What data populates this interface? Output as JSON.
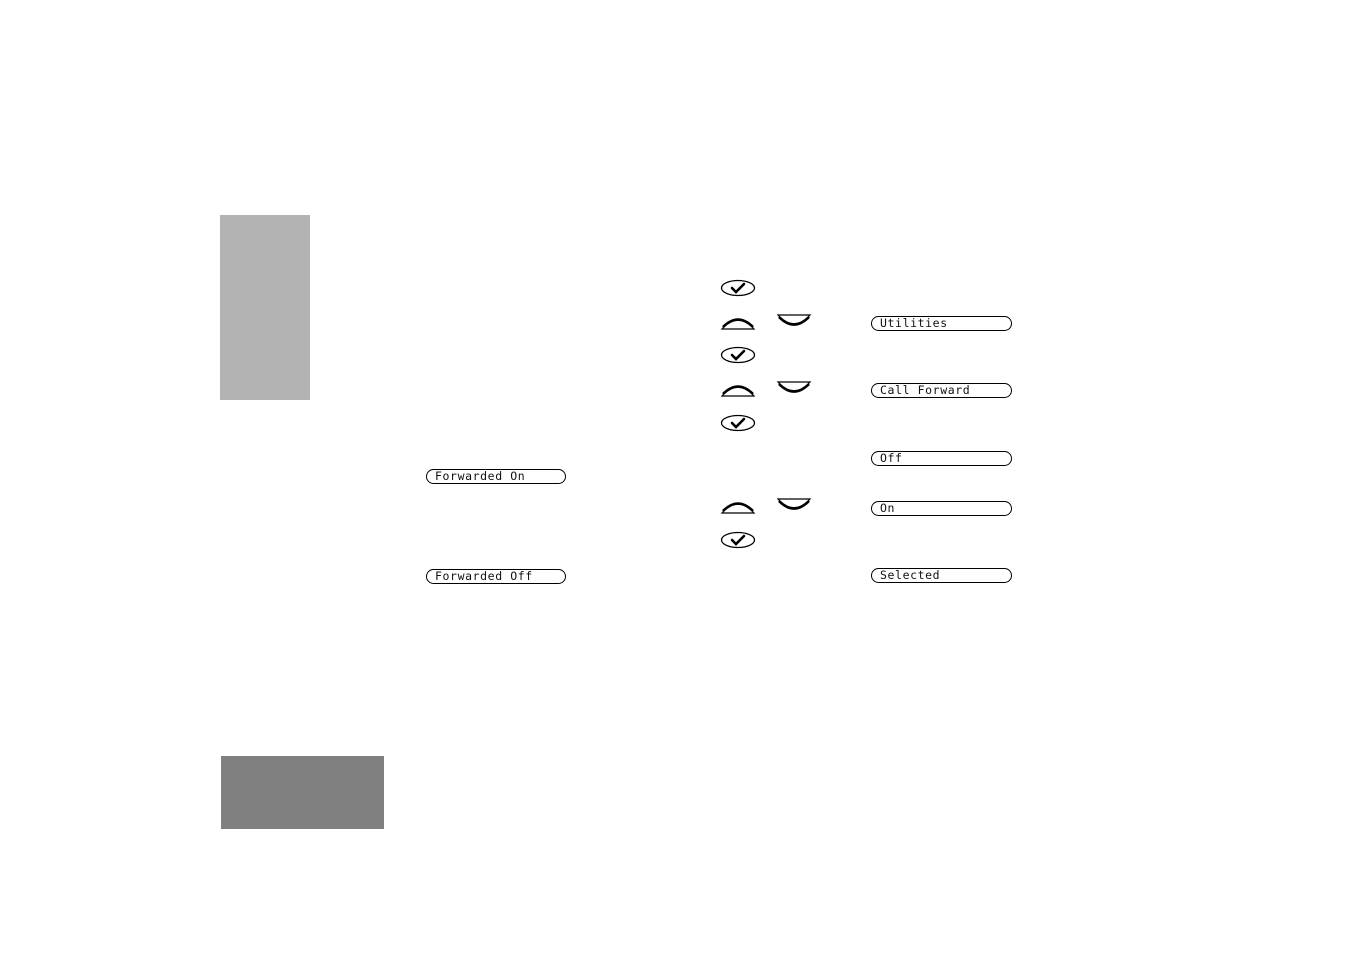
{
  "page": {
    "side_tabs": [
      {
        "name": "upper-tab",
        "color": "#b3b3b3"
      },
      {
        "name": "lower-tab",
        "color": "#808080"
      }
    ]
  },
  "procedure": {
    "steps": [
      {
        "keys": [
          "select-key"
        ],
        "display": ""
      },
      {
        "keys": [
          "scroll-up-key",
          "scroll-down-key"
        ],
        "display": "Utilities"
      },
      {
        "keys": [
          "select-key"
        ],
        "display": ""
      },
      {
        "keys": [
          "scroll-up-key",
          "scroll-down-key"
        ],
        "display": "Call Forward"
      },
      {
        "keys": [
          "select-key"
        ],
        "display": "Off"
      },
      {
        "keys": [
          "scroll-up-key",
          "scroll-down-key"
        ],
        "display": "On"
      },
      {
        "keys": [
          "select-key"
        ],
        "display": ""
      },
      {
        "keys": [],
        "display": "Selected"
      }
    ]
  },
  "status_displays": {
    "forwarded_on": "Forwarded On",
    "forwarded_off": "Forwarded Off"
  },
  "displays": {
    "utilities": "Utilities",
    "call_forward": "Call Forward",
    "off": "Off",
    "on": "On",
    "selected": "Selected"
  }
}
